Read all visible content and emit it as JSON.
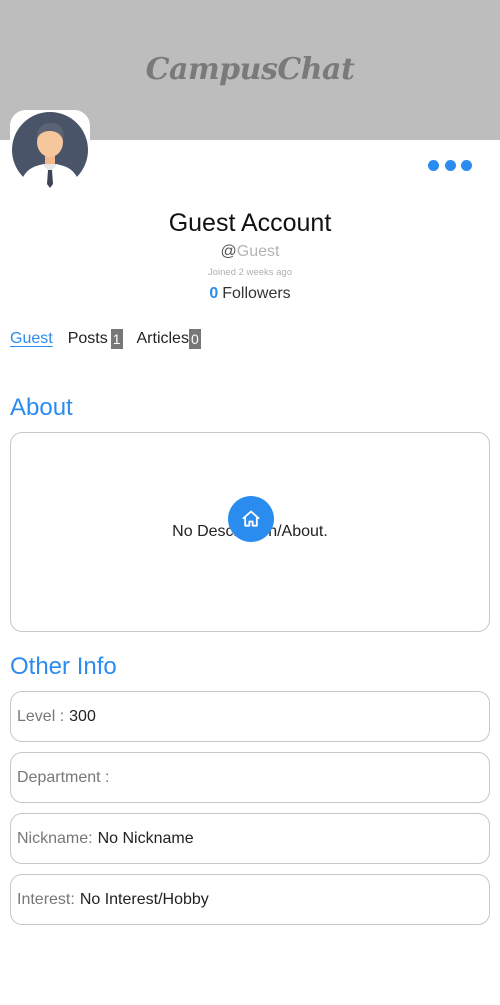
{
  "header": {
    "brand": "CampusChat",
    "banner_color": "#bdbdbd"
  },
  "profile": {
    "name": "Guest Account",
    "handle_prefix": "@",
    "handle": "Guest",
    "joined": "Joined 2 weeks ago",
    "followers_count": "0",
    "followers_label": "Followers",
    "avatar_icon": "user-avatar-icon",
    "more_icon": "more-dots-icon"
  },
  "tabs": [
    {
      "label": "Guest",
      "badge": ""
    },
    {
      "label": "Posts",
      "badge": "1"
    },
    {
      "label": "Articles",
      "badge": "0"
    }
  ],
  "about": {
    "title": "About",
    "text": "No Description/About."
  },
  "fab": {
    "icon": "home-icon"
  },
  "other_info": {
    "title": "Other Info",
    "rows": [
      {
        "label": "Level :",
        "value": "300"
      },
      {
        "label": "Department :",
        "value": ""
      },
      {
        "label": "Nickname:",
        "value": "No Nickname"
      },
      {
        "label": "Interest:",
        "value": "No Interest/Hobby"
      }
    ]
  },
  "colors": {
    "accent": "#2b8cf0",
    "badge": "#777777",
    "border": "#c8c8c8"
  }
}
